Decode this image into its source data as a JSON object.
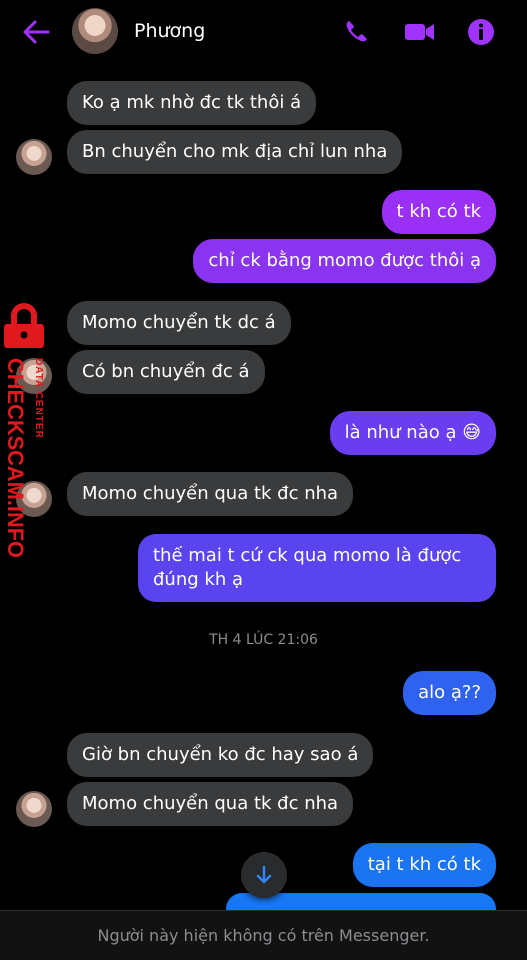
{
  "header": {
    "contact_name": "Phương",
    "back_icon": "arrow-left-icon",
    "call_icon": "phone-icon",
    "video_icon": "video-camera-icon",
    "info_icon": "info-icon",
    "accent_color": "#a033ff"
  },
  "messages": [
    {
      "from": "them",
      "text": "Ko ạ mk nhờ đc tk thôi á"
    },
    {
      "from": "them",
      "text": "Bn chuyển cho mk địa chỉ lun nha"
    },
    {
      "from": "me",
      "text": "t kh có tk"
    },
    {
      "from": "me",
      "text": "chỉ ck bằng momo được thôi ạ"
    },
    {
      "from": "them",
      "text": "Momo chuyển tk dc á"
    },
    {
      "from": "them",
      "text": "Có bn chuyển đc á"
    },
    {
      "from": "me",
      "text": "là như nào ạ 😅"
    },
    {
      "from": "them",
      "text": "Momo chuyển qua tk đc nha"
    },
    {
      "from": "me",
      "text": "thế mai t cứ ck qua momo là được đúng kh ạ"
    },
    {
      "from": "me",
      "text": "alo ạ??"
    },
    {
      "from": "them",
      "text": "Giờ bn chuyển ko đc hay sao á"
    },
    {
      "from": "them",
      "text": "Momo chuyển qua tk đc nha"
    },
    {
      "from": "me",
      "text": "tại t kh có tk"
    }
  ],
  "timestamp": "TH 4 LÚC 21:06",
  "scroll_down_icon": "arrow-down-icon",
  "footer": {
    "notice": "Người này hiện không có trên Messenger."
  },
  "watermark": {
    "text": "CHECKSCAM.INFO",
    "subtext": "DATA CENTER",
    "icon": "padlock-icon",
    "color": "#e0191f"
  }
}
